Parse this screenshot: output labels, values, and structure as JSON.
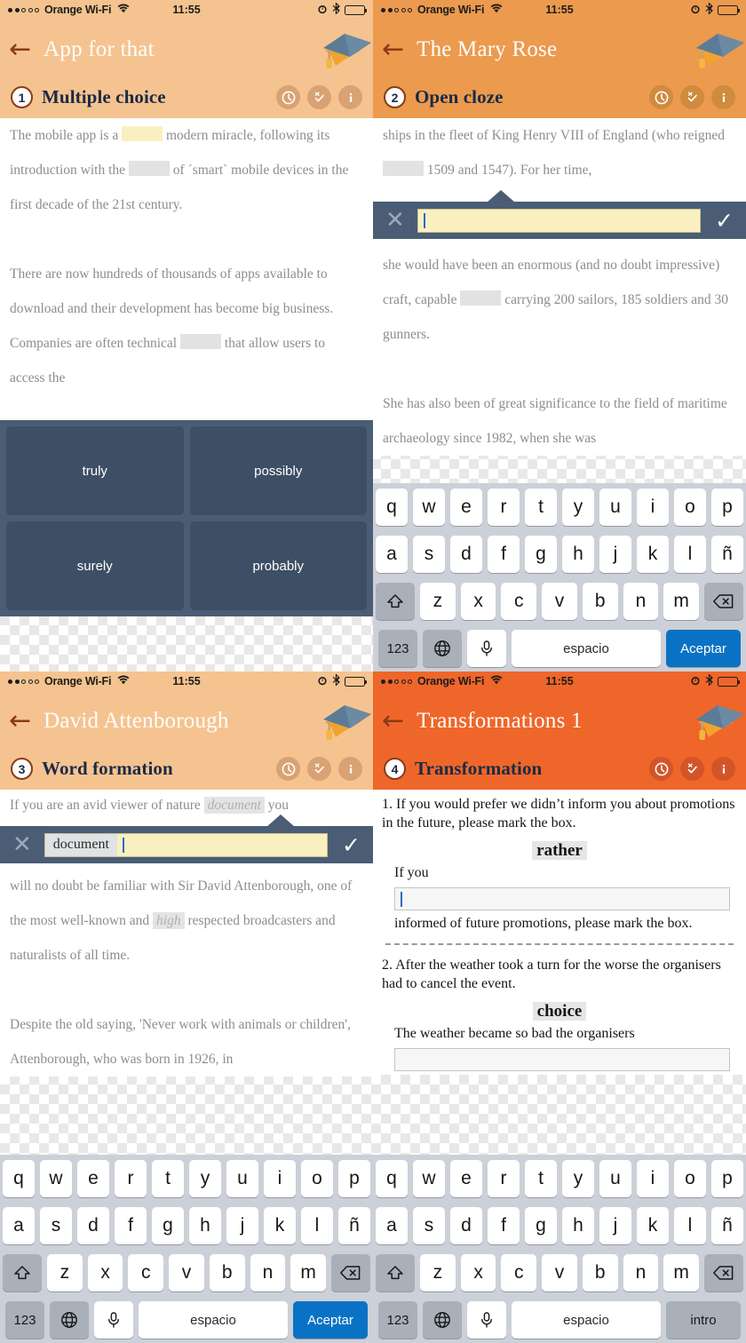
{
  "statusbar": {
    "carrier": "Orange Wi-Fi",
    "time": "11:55",
    "signal_dots_filled": 2,
    "signal_dots_total": 5,
    "icons": [
      "alarm-icon",
      "bluetooth-icon",
      "battery-icon"
    ]
  },
  "colors": {
    "header_peach": "#F5C390",
    "header_orange": "#EB9A4E",
    "header_deep_orange": "#EF662A",
    "answerbar": "#4A5D75",
    "option_button": "#3D4F65",
    "accept_key_blue": "#0A72C4",
    "highlight_yellow": "#FAF0BF",
    "blank_grey": "#E2E2E2",
    "title_navy": "#1B2A45",
    "back_arrow": "#8C3A16"
  },
  "task_icons": [
    "clock-icon",
    "check-cross-icon",
    "info-icon"
  ],
  "panels": [
    {
      "id": "multiple-choice",
      "app_title": "App for that",
      "task_number": "1",
      "task_title": "Multiple choice",
      "header_color": "#F5C390",
      "paragraphs": [
        [
          {
            "t": "text",
            "v": "The mobile app is a "
          },
          {
            "t": "blank",
            "style": "yellow"
          },
          {
            "t": "text",
            "v": " modern miracle, following its introduction with the "
          },
          {
            "t": "blank",
            "style": "grey"
          },
          {
            "t": "text",
            "v": " of ´smart` mobile devices in the first decade of the 21st century."
          }
        ],
        [
          {
            "t": "text",
            "v": "There are now hundreds of thousands of apps available to download and their development has become big business. Companies are often technical "
          },
          {
            "t": "blank",
            "style": "grey"
          },
          {
            "t": "text",
            "v": " that allow users to access the"
          }
        ]
      ],
      "options": [
        "truly",
        "possibly",
        "surely",
        "probably"
      ],
      "keyboard": null
    },
    {
      "id": "open-cloze",
      "app_title": "The Mary Rose",
      "task_number": "2",
      "task_title": "Open cloze",
      "header_color": "#EB9A4E",
      "text_before": [
        {
          "t": "text",
          "v": "ships in the fleet of King Henry VIII of England (who reigned "
        },
        {
          "t": "blank",
          "style": "grey"
        },
        {
          "t": "text",
          "v": " 1509 and 1547). For her time,"
        }
      ],
      "answer_bar": {
        "prefix": "",
        "value": "",
        "cancel": "close-icon",
        "confirm": "check-icon"
      },
      "text_after": [
        {
          "t": "text",
          "v": " she would have been an enormous (and no doubt impressive) craft, capable "
        },
        {
          "t": "blank",
          "style": "grey"
        },
        {
          "t": "text",
          "v": " carrying 200 sailors, 185 soldiers and 30 gunners."
        }
      ],
      "text_after2": [
        {
          "t": "text",
          "v": "She has also been of great significance to the field of maritime archaeology since 1982, when she was"
        }
      ],
      "keyboard": {
        "action_label": "Aceptar",
        "action_style": "blue",
        "space_label": "espacio",
        "num_label": "123"
      }
    },
    {
      "id": "word-formation",
      "app_title": "David Attenborough",
      "task_number": "3",
      "task_title": "Word formation",
      "header_color": "#F5C390",
      "text_before": [
        {
          "t": "text",
          "v": "If you are an avid viewer of nature "
        },
        {
          "t": "hint",
          "v": "document"
        },
        {
          "t": "text",
          "v": " you"
        }
      ],
      "answer_bar": {
        "prefix": "document",
        "value": "",
        "cancel": "close-icon",
        "confirm": "check-icon"
      },
      "text_after": [
        {
          "t": "text",
          "v": " will no doubt be familiar with Sir David Attenborough, one of the most well-known and "
        },
        {
          "t": "hint",
          "v": "high"
        },
        {
          "t": "text",
          "v": " respected broadcasters and naturalists of all time."
        }
      ],
      "text_after2": [
        {
          "t": "text",
          "v": "Despite the old saying, 'Never work with animals or children', Attenborough, who was born in 1926, in"
        }
      ],
      "keyboard": {
        "action_label": "Aceptar",
        "action_style": "blue",
        "space_label": "espacio",
        "num_label": "123"
      }
    },
    {
      "id": "transformation",
      "app_title": "Transformations 1",
      "task_number": "4",
      "task_title": "Transformation",
      "header_color": "#EF662A",
      "items": [
        {
          "prompt": "1. If you would prefer we didn’t inform you about promotions in the future, please mark the box.",
          "keyword": "rather",
          "fragment_before": "If you",
          "input_value": "",
          "focused": true,
          "fragment_after": " informed of future promotions, please mark the box."
        },
        {
          "prompt": "2. After the weather took a turn for the worse the organisers had to cancel the event.",
          "keyword": "choice",
          "fragment_before": "The weather became so bad the organisers",
          "input_value": "",
          "focused": false,
          "fragment_after": ""
        }
      ],
      "keyboard": {
        "action_label": "intro",
        "action_style": "dark",
        "space_label": "espacio",
        "num_label": "123"
      }
    }
  ],
  "keyboard_rows": {
    "row1": [
      "q",
      "w",
      "e",
      "r",
      "t",
      "y",
      "u",
      "i",
      "o",
      "p"
    ],
    "row2": [
      "a",
      "s",
      "d",
      "f",
      "g",
      "h",
      "j",
      "k",
      "l",
      "ñ"
    ],
    "row3": [
      "z",
      "x",
      "c",
      "v",
      "b",
      "n",
      "m"
    ],
    "shift_icon": "shift-icon",
    "backspace_icon": "backspace-icon",
    "globe_icon": "globe-icon",
    "mic_icon": "microphone-icon"
  }
}
